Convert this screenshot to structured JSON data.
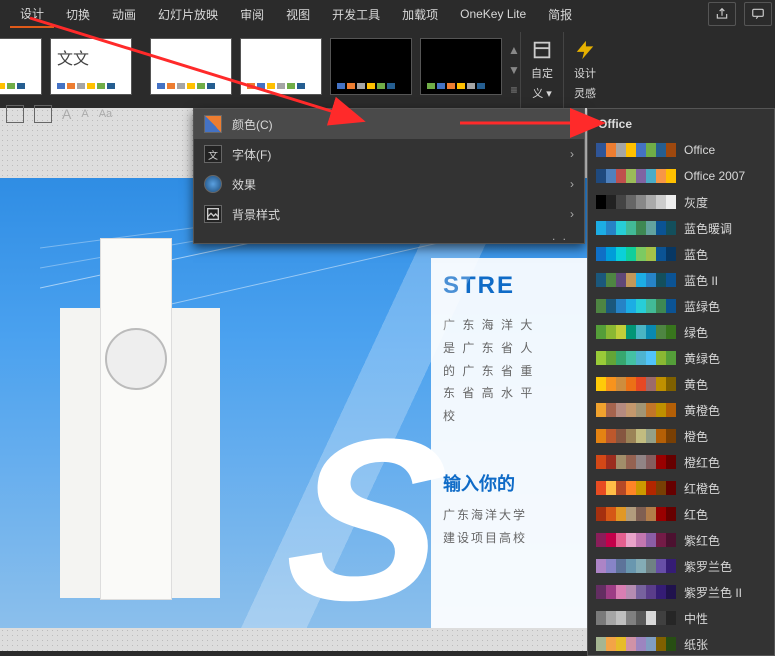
{
  "ribbon_tabs": {
    "active": "设计",
    "tabs": [
      "设计",
      "切换",
      "动画",
      "幻灯片放映",
      "审阅",
      "视图",
      "开发工具",
      "加载项",
      "OneKey Lite",
      "简报"
    ]
  },
  "ribbon_groups": {
    "customize": {
      "label": "自定",
      "sub": "义 ▾"
    },
    "design_ideas": {
      "label": "设计",
      "sub": "灵感"
    }
  },
  "theme_thumbs": {
    "aa": "文文"
  },
  "dropdown": {
    "items": [
      {
        "label": "颜色(C)",
        "icon": "palette"
      },
      {
        "label": "字体(F)",
        "icon": "font"
      },
      {
        "label": "效果",
        "icon": "effects"
      },
      {
        "label": "背景样式",
        "icon": "background"
      }
    ]
  },
  "flyout": {
    "header": "Office",
    "rows": [
      {
        "label": "Office",
        "c": [
          "#2f5597",
          "#ed7d31",
          "#a5a5a5",
          "#ffc000",
          "#4472c4",
          "#70ad47",
          "#255e91",
          "#9e480e"
        ]
      },
      {
        "label": "Office 2007",
        "c": [
          "#1f497d",
          "#4f81bd",
          "#c0504d",
          "#9bbb59",
          "#8064a2",
          "#4bacc6",
          "#f79646",
          "#ffc000"
        ]
      },
      {
        "label": "灰度",
        "c": [
          "#000",
          "#222",
          "#444",
          "#666",
          "#888",
          "#aaa",
          "#ccc",
          "#eee"
        ]
      },
      {
        "label": "蓝色暖调",
        "c": [
          "#1cade4",
          "#2683c6",
          "#27ced7",
          "#42ba97",
          "#3e8853",
          "#62a39f",
          "#0b5394",
          "#134f5c"
        ]
      },
      {
        "label": "蓝色",
        "c": [
          "#0f6fc6",
          "#009dd9",
          "#0bd0d9",
          "#10cf9b",
          "#7cca62",
          "#a5c249",
          "#0b5394",
          "#073763"
        ]
      },
      {
        "label": "蓝色 II",
        "c": [
          "#1b587c",
          "#4e8542",
          "#604878",
          "#c19859",
          "#1cade4",
          "#2683c6",
          "#134f5c",
          "#0b5394"
        ]
      },
      {
        "label": "蓝绿色",
        "c": [
          "#4e8542",
          "#1b587c",
          "#2683c6",
          "#1cade4",
          "#27ced7",
          "#42ba97",
          "#3e8853",
          "#0b5394"
        ]
      },
      {
        "label": "绿色",
        "c": [
          "#549e39",
          "#8ab833",
          "#c0cf3a",
          "#029676",
          "#4ab5c4",
          "#0989b1",
          "#4e8542",
          "#38761d"
        ]
      },
      {
        "label": "黄绿色",
        "c": [
          "#99cb38",
          "#63a537",
          "#37a76f",
          "#44c1a3",
          "#4eb3cf",
          "#51c3f9",
          "#8ab833",
          "#549e39"
        ]
      },
      {
        "label": "黄色",
        "c": [
          "#ffca08",
          "#f8931d",
          "#ce8d3e",
          "#ec7016",
          "#e64823",
          "#9c6a6a",
          "#bf9000",
          "#7f6000"
        ]
      },
      {
        "label": "黄橙色",
        "c": [
          "#f0a22e",
          "#a5644e",
          "#b58b80",
          "#c3986d",
          "#a19574",
          "#c17529",
          "#bf9000",
          "#b45f06"
        ]
      },
      {
        "label": "橙色",
        "c": [
          "#e48312",
          "#bd582c",
          "#865640",
          "#9b8357",
          "#c2bc80",
          "#94a088",
          "#b45f06",
          "#783f04"
        ]
      },
      {
        "label": "橙红色",
        "c": [
          "#d34817",
          "#9b2d1f",
          "#a28e6a",
          "#956251",
          "#918485",
          "#855d5d",
          "#990000",
          "#660000"
        ]
      },
      {
        "label": "红橙色",
        "c": [
          "#e84c22",
          "#ffbd47",
          "#b64926",
          "#ff8427",
          "#cc9900",
          "#b22600",
          "#783f04",
          "#660000"
        ]
      },
      {
        "label": "红色",
        "c": [
          "#a5300f",
          "#d55816",
          "#e19825",
          "#b19c7d",
          "#7f5f52",
          "#b27d49",
          "#990000",
          "#660000"
        ]
      },
      {
        "label": "紫红色",
        "c": [
          "#8a1e5a",
          "#c3004a",
          "#e45f8f",
          "#e9a3c9",
          "#c377b0",
          "#8b5ea6",
          "#741b47",
          "#4c1130"
        ]
      },
      {
        "label": "紫罗兰色",
        "c": [
          "#ad84c6",
          "#8784c7",
          "#5d739a",
          "#6997af",
          "#84acb6",
          "#6f8183",
          "#674ea7",
          "#351c75"
        ]
      },
      {
        "label": "紫罗兰色 II",
        "c": [
          "#632e62",
          "#9d3d85",
          "#d97eb3",
          "#b58cb2",
          "#77629e",
          "#5a3d8a",
          "#351c75",
          "#20124d"
        ]
      },
      {
        "label": "中性",
        "c": [
          "#7a7a7a",
          "#a5a5a5",
          "#bfbfbf",
          "#808080",
          "#595959",
          "#d9d9d9",
          "#404040",
          "#262626"
        ]
      },
      {
        "label": "纸张",
        "c": [
          "#a5b592",
          "#f3a447",
          "#e7bc29",
          "#d092a7",
          "#9c85c0",
          "#809ec2",
          "#7f6000",
          "#274e13"
        ]
      }
    ]
  },
  "slide": {
    "title": "STRE",
    "desc1_l1": "广 东 海 洋 大",
    "desc1_l2": "是 广 东 省 人",
    "desc1_l3": "的 广 东 省 重",
    "desc1_l4": "东 省 高 水 平",
    "desc1_l5": "校",
    "title2": "输入你的",
    "desc2_l1": "广东海洋大学",
    "desc2_l2": "建设项目高校"
  }
}
